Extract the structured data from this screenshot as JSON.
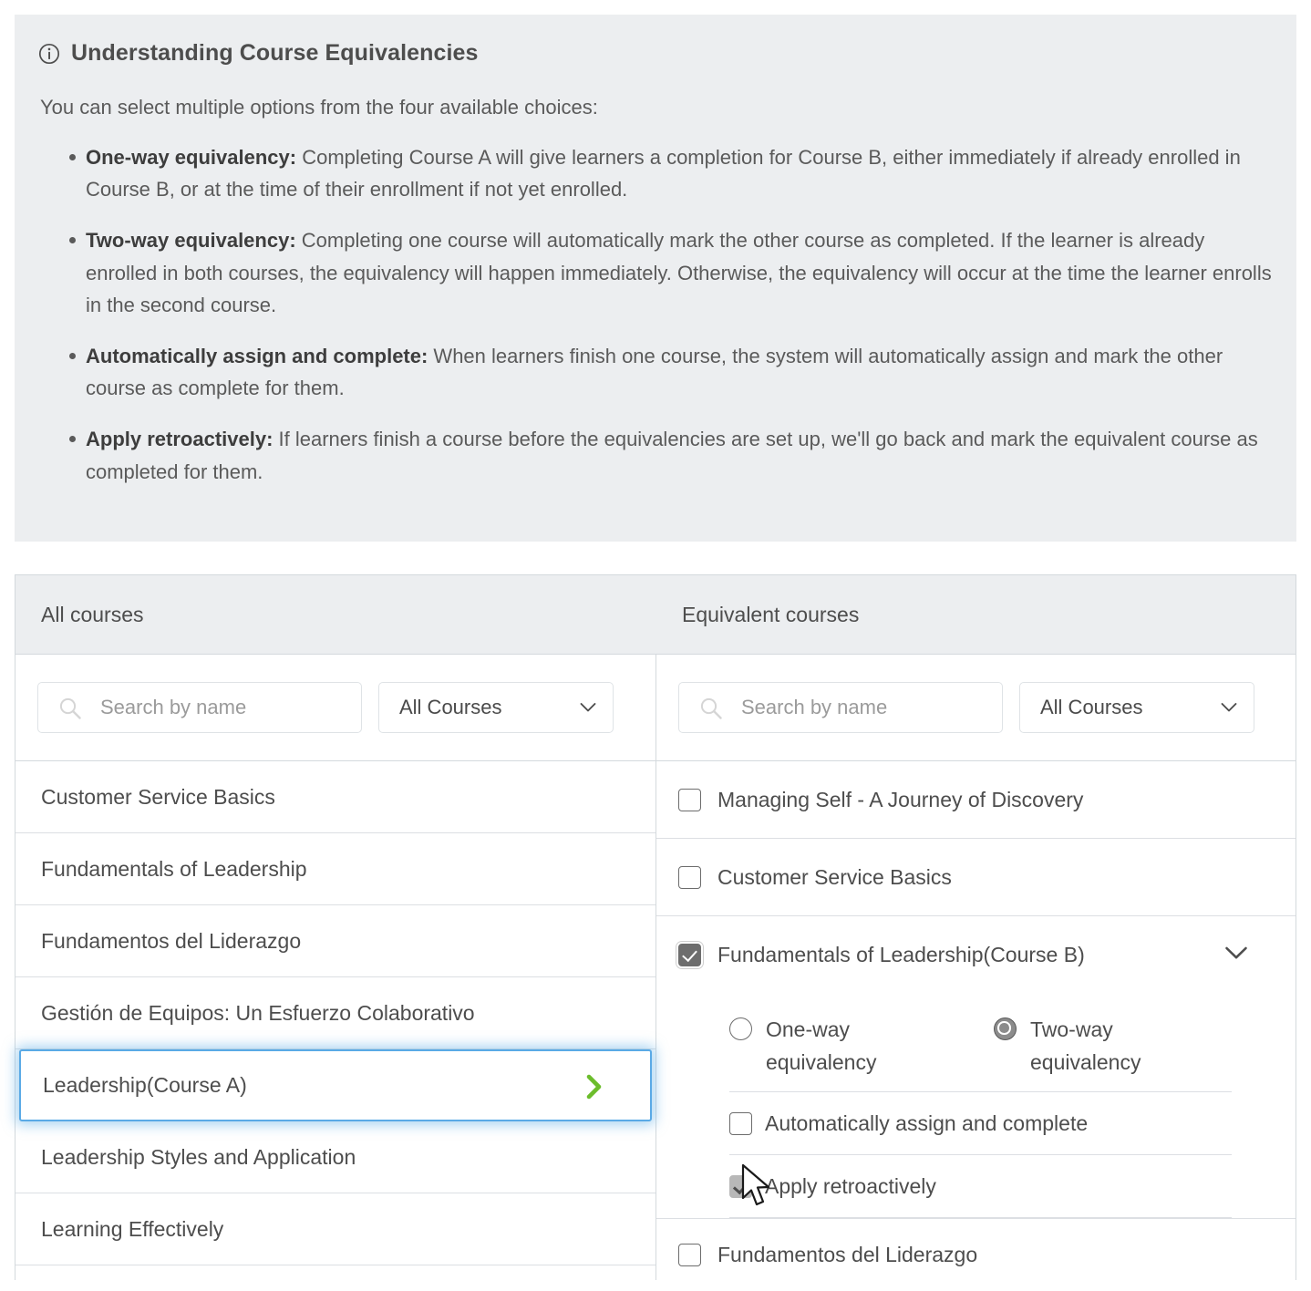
{
  "info": {
    "icon": "info-circle-icon",
    "title": "Understanding Course Equivalencies",
    "lead": "You can select multiple options from the four available choices:",
    "bullets": [
      {
        "term": "One-way equivalency:",
        "text": " Completing Course A will give learners a completion for Course B, either immediately if already enrolled in Course B, or at the time of their enrollment if not yet enrolled."
      },
      {
        "term": "Two-way equivalency:",
        "text": " Completing one course will automatically mark the other course as completed. If the learner is already enrolled in both courses, the equivalency will happen immediately. Otherwise, the equivalency will occur at the time the learner enrolls in the second course."
      },
      {
        "term": "Automatically assign and complete:",
        "text": " When learners finish one course, the system will automatically assign and mark the other course as complete for them."
      },
      {
        "term": "Apply retroactively:",
        "text": " If learners finish a course before the equivalencies are set up, we'll go back and mark the equivalent course as completed for them."
      }
    ]
  },
  "left_panel": {
    "header": "All courses",
    "search": {
      "value": "",
      "placeholder": "Search by name",
      "icon": "search-icon"
    },
    "filter": {
      "selected": "All Courses",
      "icon": "chevron-down-icon"
    },
    "items": [
      {
        "label": "Customer Service Basics",
        "selected": false
      },
      {
        "label": "Fundamentals of Leadership",
        "selected": false
      },
      {
        "label": "Fundamentos del Liderazgo",
        "selected": false
      },
      {
        "label": "Gestión de Equipos: Un Esfuerzo Colaborativo",
        "selected": false
      },
      {
        "label": "Leadership ",
        "suffix": "(Course A)",
        "selected": true,
        "icon": "chevron-right-icon"
      },
      {
        "label": "Leadership Styles and Application",
        "selected": false
      },
      {
        "label": "Learning Effectively",
        "selected": false
      }
    ]
  },
  "right_panel": {
    "header": "Equivalent courses",
    "search": {
      "value": "",
      "placeholder": "Search by name",
      "icon": "search-icon"
    },
    "filter": {
      "selected": "All Courses",
      "icon": "chevron-down-icon"
    },
    "items": [
      {
        "label": "Managing Self - A Journey of Discovery",
        "checked": false,
        "expanded": false
      },
      {
        "label": "Customer Service Basics",
        "checked": false,
        "expanded": false
      },
      {
        "label": "Fundamentals of Leadership ",
        "suffix": "(Course B)",
        "checked": true,
        "expanded": true,
        "icon": "chevron-down-icon"
      },
      {
        "label": "Fundamentos del Liderazgo",
        "checked": false,
        "expanded": false
      }
    ],
    "options": {
      "radios": [
        {
          "label": "One-way equivalency",
          "checked": false
        },
        {
          "label": "Two-way equivalency",
          "checked": true
        }
      ],
      "checkboxes": [
        {
          "label": "Automatically assign and complete",
          "checked": false
        },
        {
          "label": "Apply retroactively",
          "checked": true,
          "hover": true
        }
      ]
    }
  },
  "colors": {
    "panel_bg": "#eceef0",
    "border": "#d4d9dd",
    "selected_border": "#5aaae6",
    "arrow_green": "#6cbd2c",
    "text": "#4d4d4d",
    "muted": "#8b8b8b"
  }
}
